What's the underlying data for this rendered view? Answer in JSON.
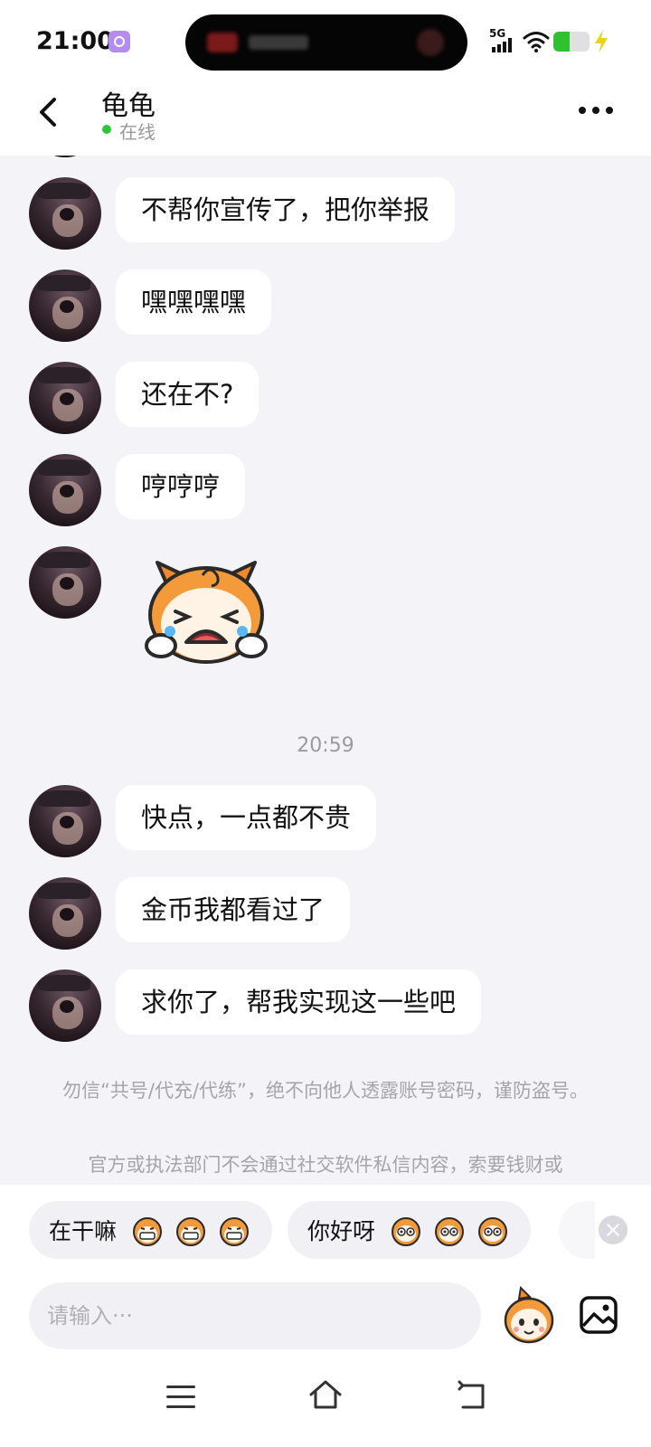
{
  "status_bar": {
    "time": "21:00",
    "network": "5G",
    "battery_level": 0.45,
    "battery_color": "#2fc12f"
  },
  "header": {
    "contact_name": "龟龟",
    "status": "在线",
    "status_color": "#2ac93c"
  },
  "messages": [
    {
      "type": "text",
      "text": "不帮你宣传了，把你举报"
    },
    {
      "type": "text",
      "text": "嘿嘿嘿嘿"
    },
    {
      "type": "text",
      "text": "还在不?"
    },
    {
      "type": "text",
      "text": "哼哼哼"
    },
    {
      "type": "sticker",
      "sticker": "crying-cartoon-sticker"
    },
    {
      "type": "text",
      "text": "快点，一点都不贵"
    },
    {
      "type": "text",
      "text": "金币我都看过了"
    },
    {
      "type": "text",
      "text": "求你了，帮我实现这一些吧"
    }
  ],
  "timestamp": "20:59",
  "notice": {
    "line1": "勿信“共号/代充/代练”，绝不向他人透露账号密码，谨防盗号。",
    "line2_partial": "官方或执法部门不会通过社交软件私信内容，索要钱财或"
  },
  "quick_replies": [
    {
      "label": "在干嘛",
      "emoji": "grinning-cartoon-emoji"
    },
    {
      "label": "你好呀",
      "emoji": "staring-cartoon-emoji"
    }
  ],
  "input": {
    "placeholder": "请输入···"
  },
  "icons": {
    "back": "chevron-left-icon",
    "more": "more-dots-icon",
    "emoji": "cartoon-emoji-icon",
    "image": "image-icon",
    "close": "close-icon",
    "nav_menu": "menu-icon",
    "nav_home": "home-icon",
    "nav_back": "back-icon"
  }
}
